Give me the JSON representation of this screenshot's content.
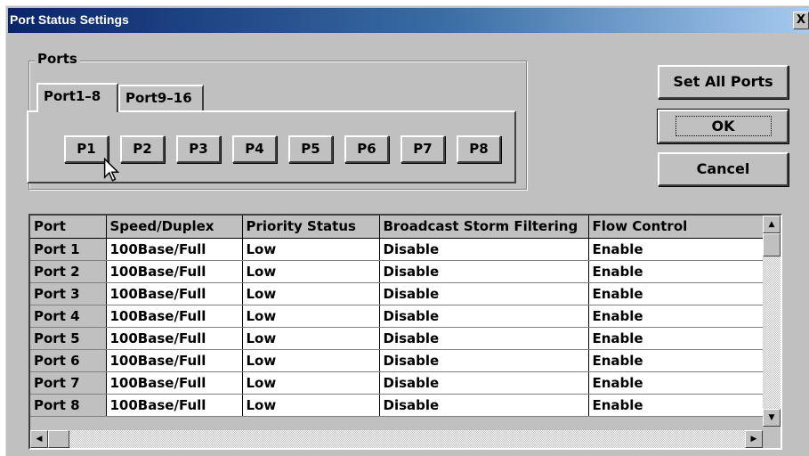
{
  "window": {
    "title": "Port Status Settings",
    "close_glyph": "X"
  },
  "ports_group": {
    "label": "Ports",
    "tabs": [
      {
        "label": "Port1–8",
        "active": true
      },
      {
        "label": "Port9–16",
        "active": false
      }
    ],
    "buttons": [
      "P1",
      "P2",
      "P3",
      "P4",
      "P5",
      "P6",
      "P7",
      "P8"
    ]
  },
  "actions": {
    "set_all": "Set All Ports",
    "ok": "OK",
    "cancel": "Cancel"
  },
  "table": {
    "columns": [
      "Port",
      "Speed/Duplex",
      "Priority Status",
      "Broadcast Storm Filtering",
      "Flow Control"
    ],
    "rows": [
      [
        "Port 1",
        "100Base/Full",
        "Low",
        "Disable",
        "Enable"
      ],
      [
        "Port 2",
        "100Base/Full",
        "Low",
        "Disable",
        "Enable"
      ],
      [
        "Port 3",
        "100Base/Full",
        "Low",
        "Disable",
        "Enable"
      ],
      [
        "Port 4",
        "100Base/Full",
        "Low",
        "Disable",
        "Enable"
      ],
      [
        "Port 5",
        "100Base/Full",
        "Low",
        "Disable",
        "Enable"
      ],
      [
        "Port 6",
        "100Base/Full",
        "Low",
        "Disable",
        "Enable"
      ],
      [
        "Port 7",
        "100Base/Full",
        "Low",
        "Disable",
        "Enable"
      ],
      [
        "Port 8",
        "100Base/Full",
        "Low",
        "Disable",
        "Enable"
      ]
    ]
  },
  "scrollbar_icons": {
    "up": "scroll-up-arrow-icon",
    "down": "scroll-down-arrow-icon",
    "left": "scroll-left-arrow-icon",
    "right": "scroll-right-arrow-icon"
  },
  "colors": {
    "face": "#c0c0c0",
    "titlebar_start": "#0a246a",
    "titlebar_end": "#a6caf0",
    "cell_bg": "#ffffff"
  }
}
